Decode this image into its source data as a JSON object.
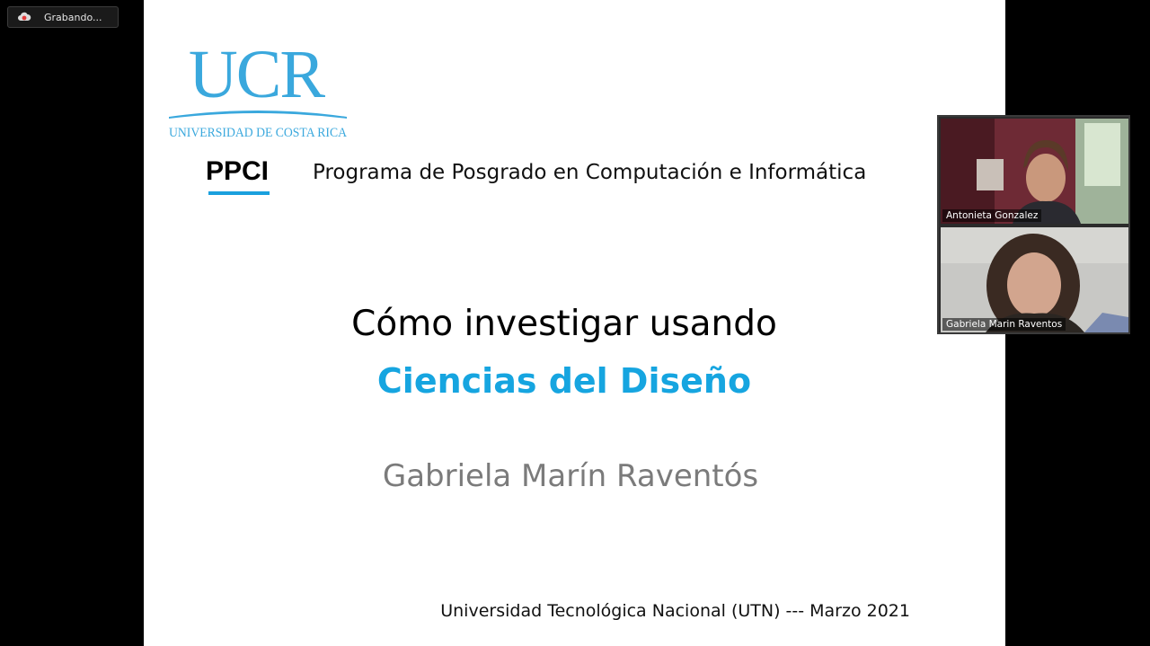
{
  "recording": {
    "label": "Grabando...",
    "icon": "cloud-record-icon"
  },
  "slide": {
    "logo": {
      "acronym": "UCR",
      "subtitle": "UNIVERSIDAD DE COSTA RICA"
    },
    "program_acronym": "PPCI",
    "program_name": "Programa de Posgrado en Computación e Informática",
    "title_line1": "Cómo investigar usando",
    "title_line2": "Ciencias del Diseño",
    "author": "Gabriela Marín Raventós",
    "footer": "Universidad Tecnológica Nacional (UTN) --- Marzo 2021"
  },
  "participants": [
    {
      "name": "Antonieta Gonzalez"
    },
    {
      "name": "Gabriela Marin Raventos"
    }
  ],
  "colors": {
    "accent_blue": "#16a5e0",
    "logo_blue": "#3aa8dd",
    "author_gray": "#7b7b7b",
    "background": "#000000"
  }
}
